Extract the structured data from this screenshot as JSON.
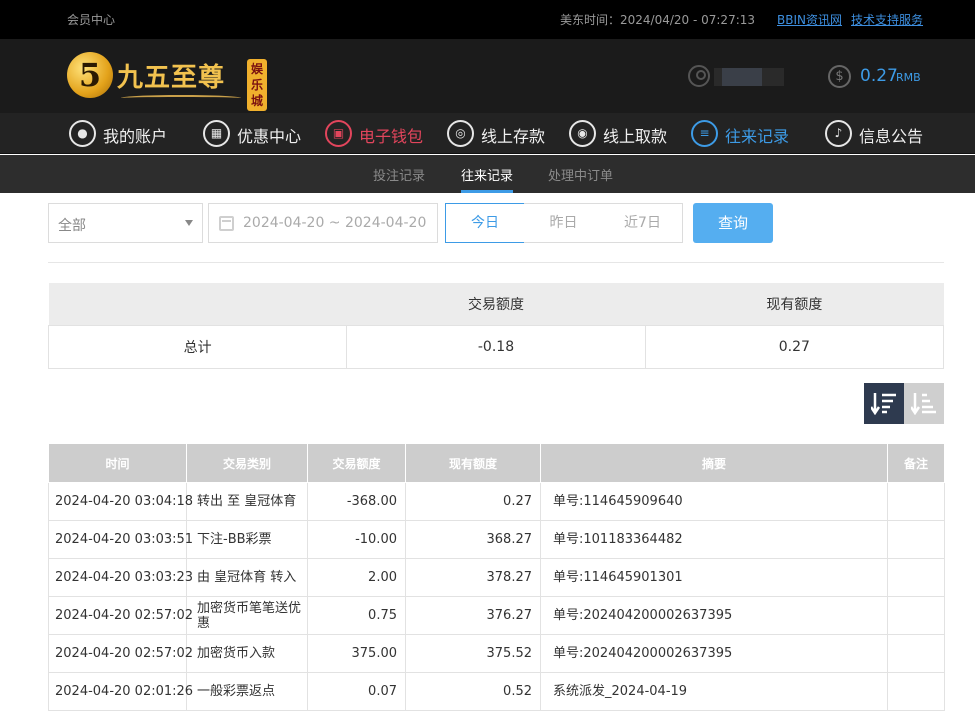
{
  "topbar": {
    "member_center": "会员中心",
    "time_label": "美东时间：2024/04/20 - 07:27:13",
    "bbin_link": "BBIN资讯网",
    "tech_link": "技术支持服务"
  },
  "header": {
    "logo_numeral": "5",
    "logo_name": "九五至尊",
    "logo_tag": "娱乐城",
    "balance_amount": "0.27",
    "balance_unit": "RMB"
  },
  "nav": {
    "items": [
      {
        "label": "我的账户",
        "icon": "user-icon"
      },
      {
        "label": "优惠中心",
        "icon": "gift-icon"
      },
      {
        "label": "电子钱包",
        "icon": "wallet-icon"
      },
      {
        "label": "线上存款",
        "icon": "deposit-icon"
      },
      {
        "label": "线上取款",
        "icon": "withdraw-icon"
      },
      {
        "label": "往来记录",
        "icon": "records-icon"
      },
      {
        "label": "信息公告",
        "icon": "bell-icon"
      }
    ],
    "active": "往来记录",
    "highlight": "电子钱包"
  },
  "subnav": {
    "tabs": [
      "投注记录",
      "往来记录",
      "处理中订单"
    ],
    "active": "往来记录"
  },
  "filters": {
    "type_value": "全部",
    "date_range": "2024-04-20 ~ 2024-04-20",
    "quick": [
      "今日",
      "昨日",
      "近7日"
    ],
    "quick_active": "今日",
    "query_label": "查询"
  },
  "summary": {
    "headers": [
      "",
      "交易额度",
      "现有额度"
    ],
    "row": [
      "总计",
      "-0.18",
      "0.27"
    ]
  },
  "records": {
    "headers": [
      "时间",
      "交易类别",
      "交易额度",
      "现有额度",
      "摘要",
      "备注"
    ],
    "rows": [
      [
        "2024-04-20 03:04:18",
        "转出 至 皇冠体育",
        "-368.00",
        "0.27",
        "单号:114645909640",
        ""
      ],
      [
        "2024-04-20 03:03:51",
        "下注-BB彩票",
        "-10.00",
        "368.27",
        "单号:101183364482",
        ""
      ],
      [
        "2024-04-20 03:03:23",
        "由 皇冠体育 转入",
        "2.00",
        "378.27",
        "单号:114645901301",
        ""
      ],
      [
        "2024-04-20 02:57:02",
        "加密货币笔笔送优惠",
        "0.75",
        "376.27",
        "单号:202404200002637395",
        ""
      ],
      [
        "2024-04-20 02:57:02",
        "加密货币入款",
        "375.00",
        "375.52",
        "单号:202404200002637395",
        ""
      ],
      [
        "2024-04-20 02:01:26",
        "一般彩票返点",
        "0.07",
        "0.52",
        "系统派发_2024-04-19",
        ""
      ]
    ]
  },
  "colors": {
    "accent": "#3d9be6",
    "highlight_red": "#e2455c",
    "header_bg": "#1b1b1b"
  }
}
